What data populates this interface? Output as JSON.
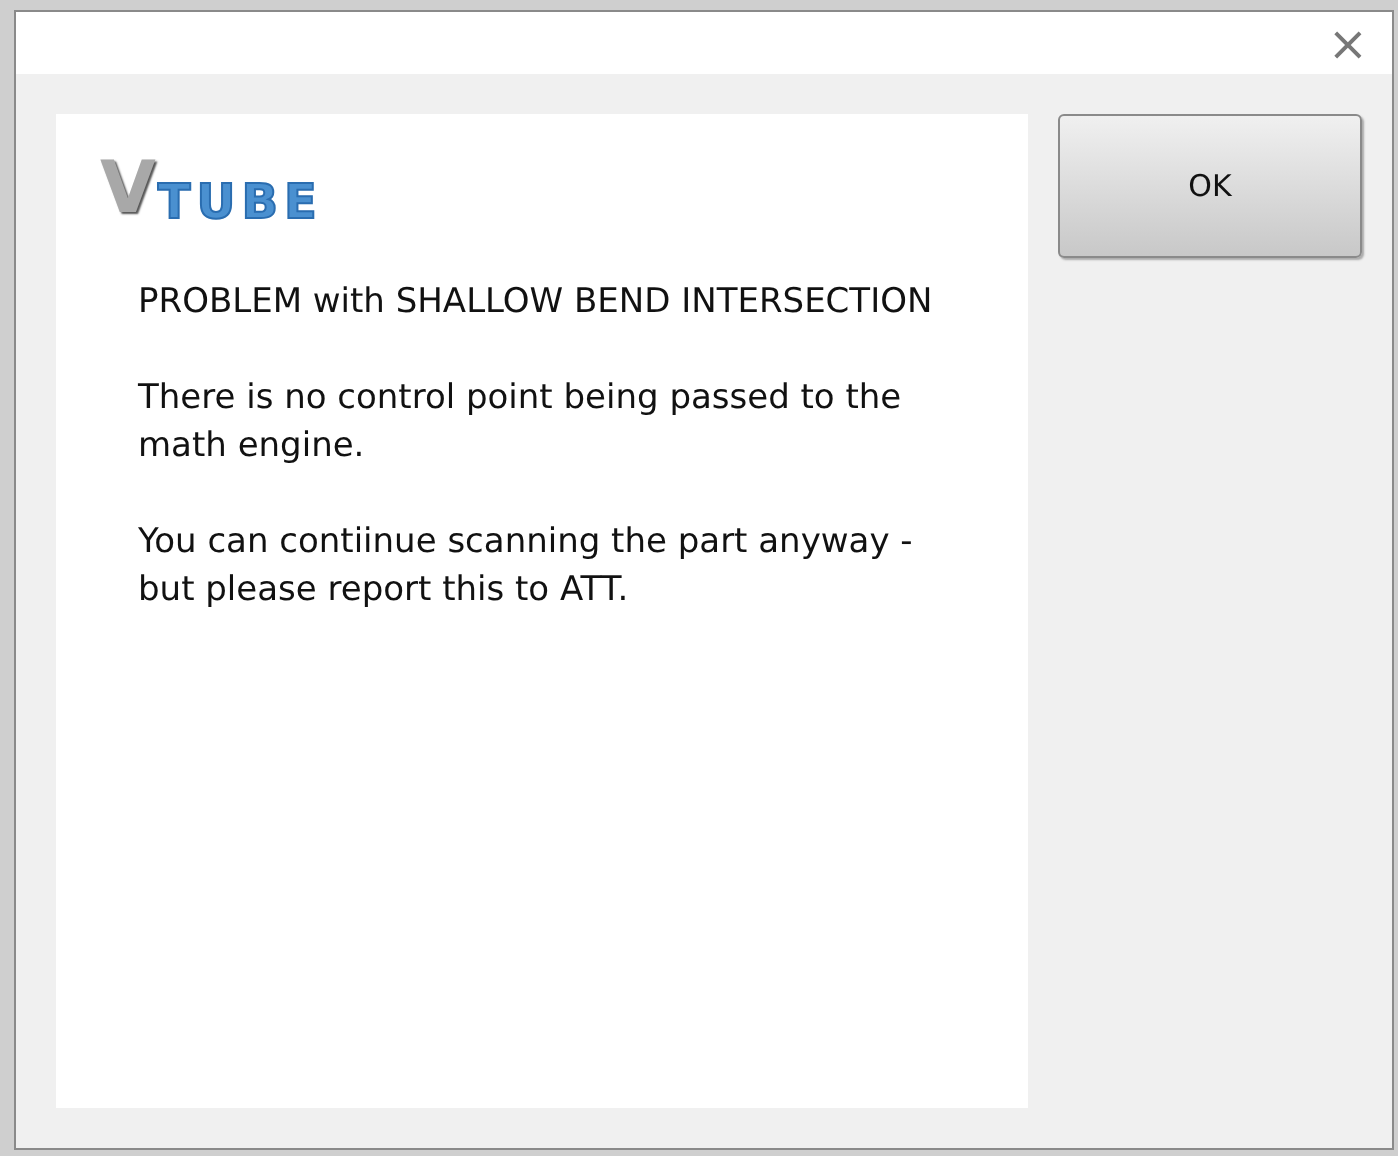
{
  "window": {
    "close": "×"
  },
  "logo": [
    "V",
    "TUBE"
  ],
  "message": {
    "title": "PROBLEM with SHALLOW BEND INTERSECTION",
    "paragraphs": [
      "There is no control point being passed to the math engine.",
      "You can contiinue scanning the part anyway - but please report this to ATT."
    ]
  },
  "buttons": [
    "OK"
  ]
}
